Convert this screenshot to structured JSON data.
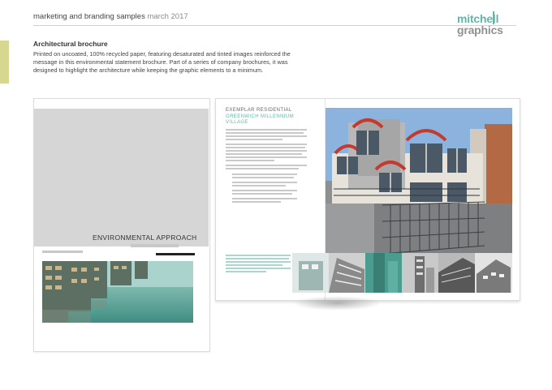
{
  "header": {
    "title": "marketing and branding samples",
    "date": "march 2017",
    "logo_line1": "mitchell",
    "logo_line2": "graphics"
  },
  "description": {
    "title": "Architectural brochure",
    "body": "Printed on uncoated, 100% recycled paper, featuring desaturated and tinted images reinforced the message in this environmental statement brochure. Part of a series of company brochures, it was designed to highlight the architecture while keeping the graphic elements to a minimum."
  },
  "cover": {
    "heading": "ENVIRONMENTAL APPROACH"
  },
  "spread": {
    "eyebrow": "EXEMPLAR RESIDENTIAL",
    "headline": "GREENWICH MILLENNIUM VILLAGE"
  },
  "colors": {
    "accent_teal": "#5fb7a9",
    "logo_grey": "#909090",
    "side_tab": "#d7d78f"
  }
}
